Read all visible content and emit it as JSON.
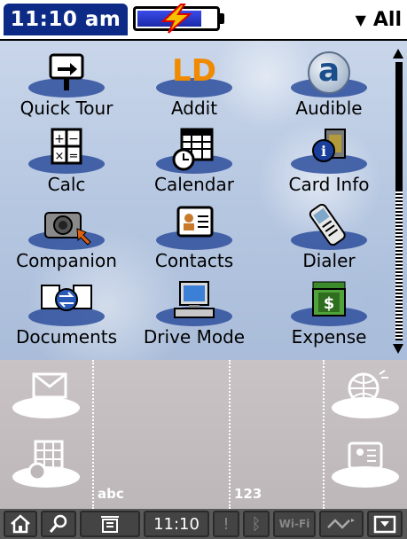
{
  "status": {
    "time": "11:10 am",
    "battery_level": 0.82,
    "charging": true
  },
  "category": {
    "selected": "All"
  },
  "apps": [
    {
      "label": "Quick Tour",
      "icon": "quick-tour-icon"
    },
    {
      "label": "Addit",
      "icon": "addit-icon"
    },
    {
      "label": "Audible",
      "icon": "audible-icon"
    },
    {
      "label": "Calc",
      "icon": "calculator-icon"
    },
    {
      "label": "Calendar",
      "icon": "calendar-icon"
    },
    {
      "label": "Card Info",
      "icon": "card-info-icon"
    },
    {
      "label": "Companion",
      "icon": "camera-icon"
    },
    {
      "label": "Contacts",
      "icon": "contacts-icon"
    },
    {
      "label": "Dialer",
      "icon": "phone-icon"
    },
    {
      "label": "Documents",
      "icon": "documents-icon"
    },
    {
      "label": "Drive Mode",
      "icon": "computer-icon"
    },
    {
      "label": "Expense",
      "icon": "expense-icon"
    }
  ],
  "addit_logo": "LD",
  "audible_logo": "a",
  "graffiti": {
    "abc_label": "abc",
    "num_label": "123"
  },
  "statusbar": {
    "time": "11:10",
    "wifi_label": "Wi-Fi"
  },
  "colors": {
    "title_tab": "#0d2b86",
    "icon_shadow": "#2e4f9c",
    "background": "#b6c7e1",
    "graffiti_bg": "#c4bec0"
  }
}
